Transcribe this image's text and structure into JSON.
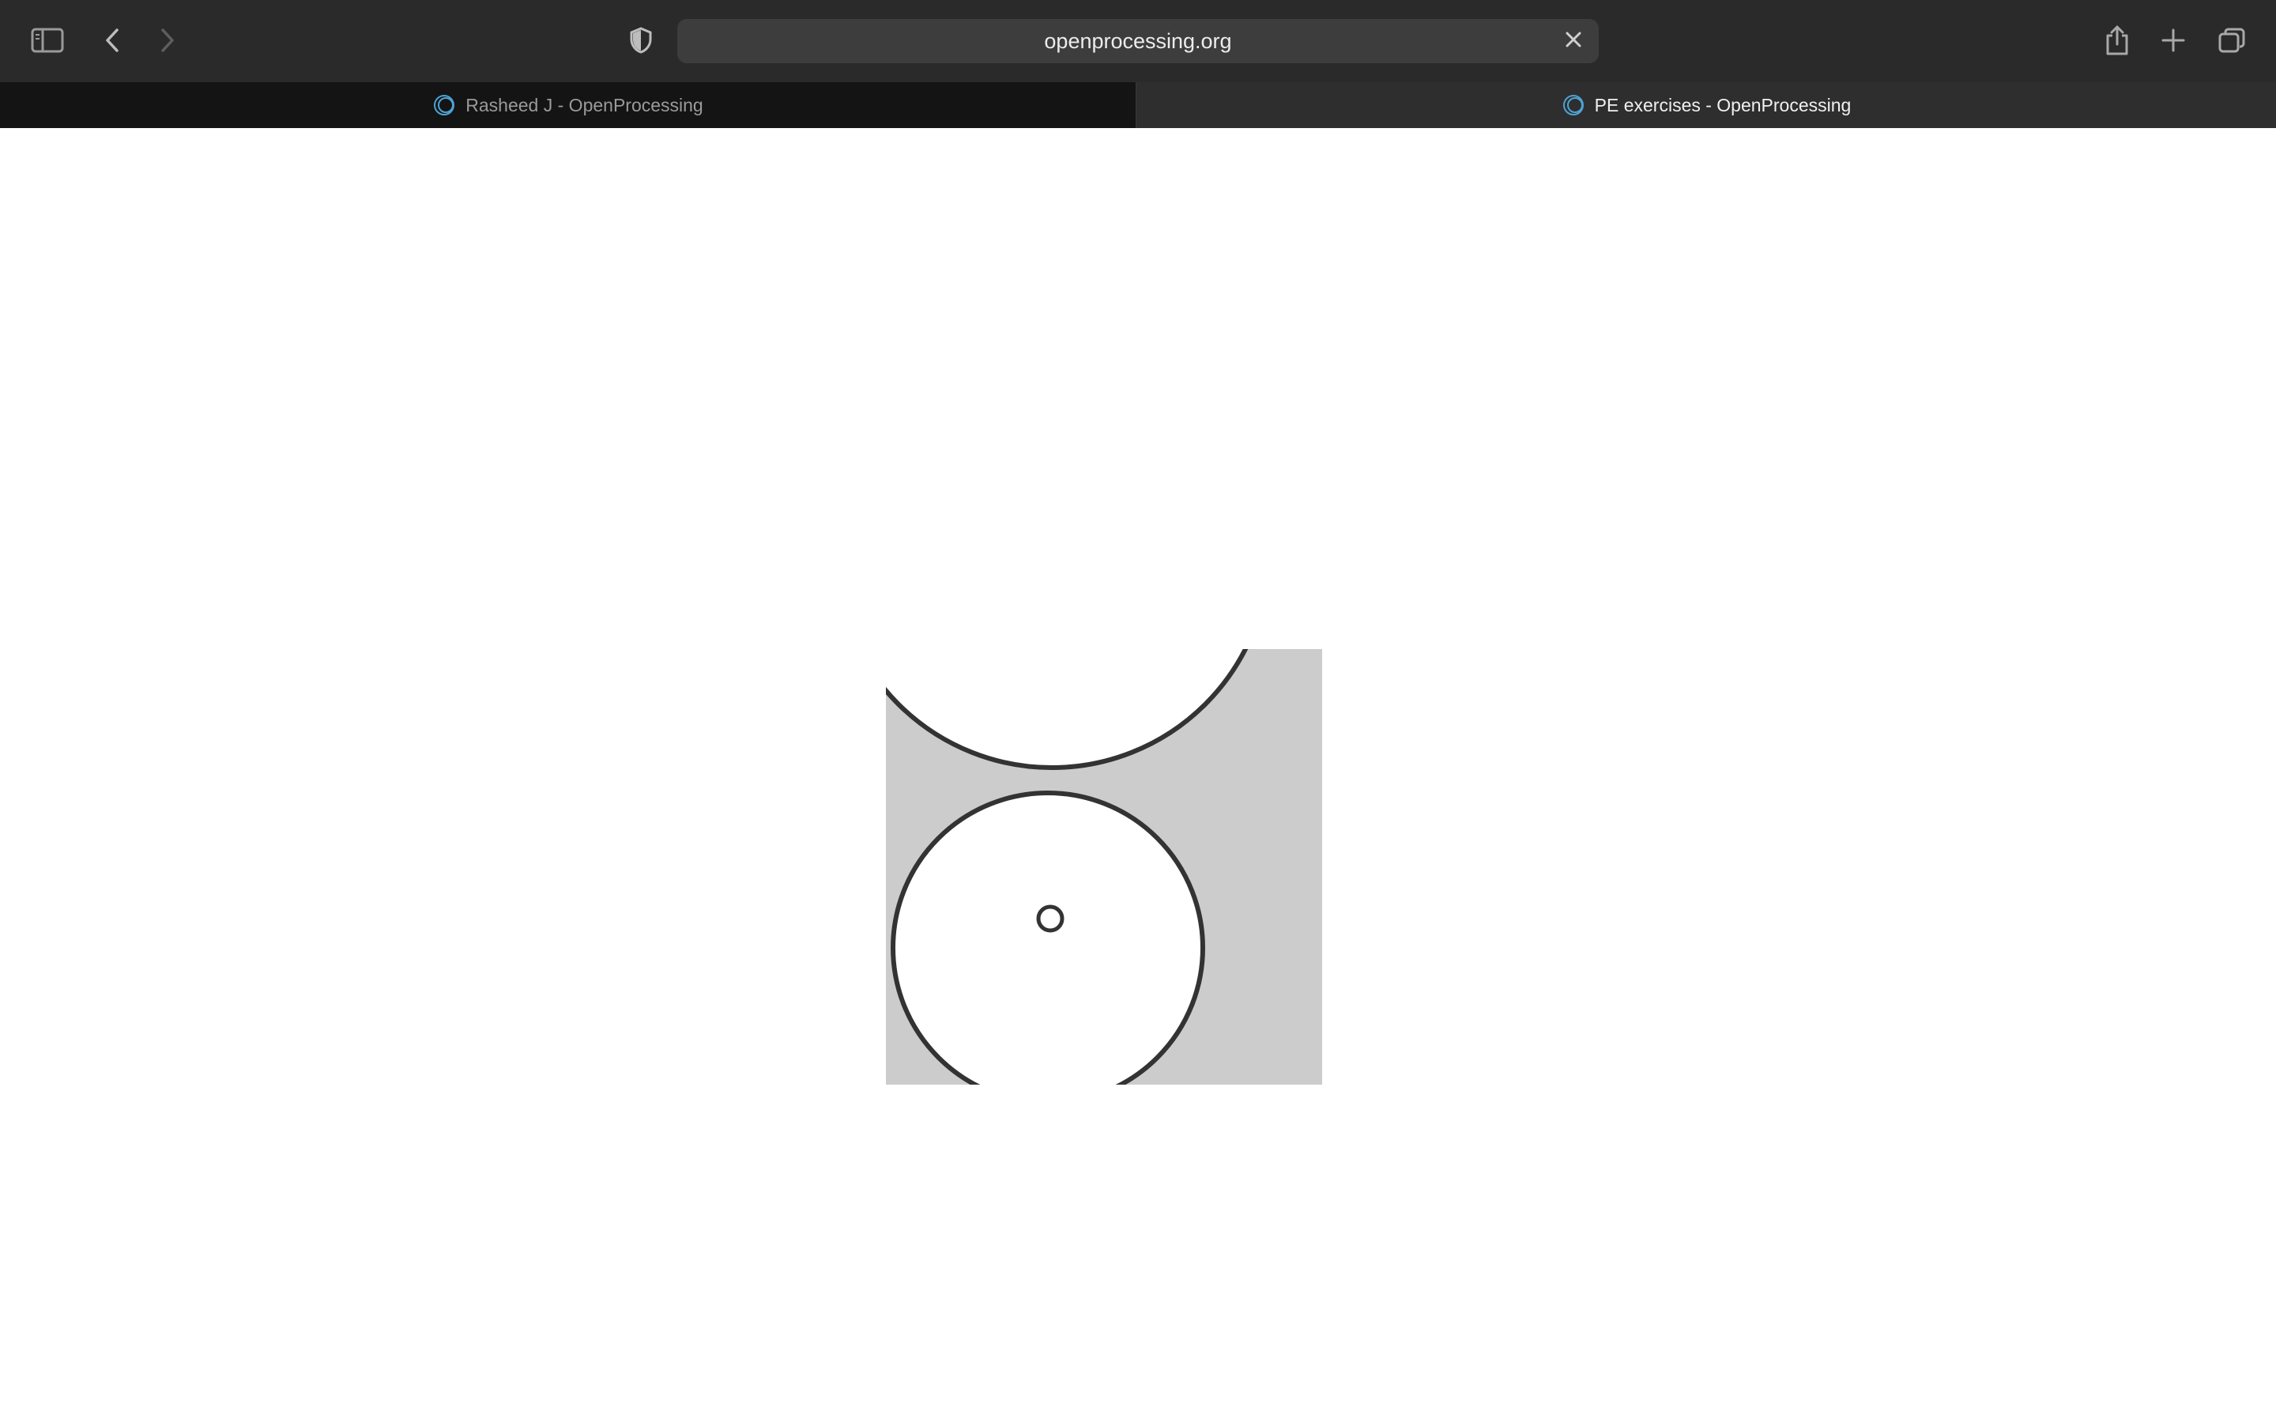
{
  "browser": {
    "address": "openprocessing.org",
    "tabs": [
      {
        "label": "Rasheed J - OpenProcessing",
        "active": false
      },
      {
        "label": "PE exercises - OpenProcessing",
        "active": true
      }
    ]
  },
  "icons": {
    "sidebar": "sidebar-icon",
    "back": "chevron-left-icon",
    "forward": "chevron-right-icon",
    "privacy": "shield-icon",
    "clear": "close-icon",
    "share": "share-icon",
    "new_tab": "plus-icon",
    "tab_overview": "tabs-overview-icon",
    "favicon": "openprocessing-logo-icon"
  },
  "colors": {
    "toolbar": "#2a2a2a",
    "address_field": "#3d3d3d",
    "sketch_fill": "#cccccc",
    "sketch_stroke": "#333333",
    "favicon": "#4da3d4"
  }
}
